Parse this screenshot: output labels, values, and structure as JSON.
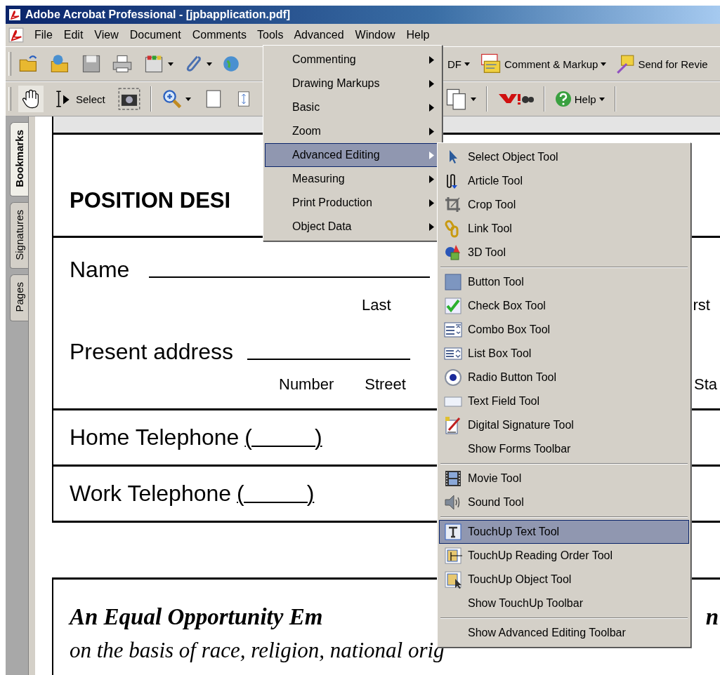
{
  "window": {
    "title": "Adobe Acrobat Professional - [jpbapplication.pdf]"
  },
  "menu_bar": [
    {
      "label": "File",
      "selected": false
    },
    {
      "label": "Edit",
      "selected": false
    },
    {
      "label": "View",
      "selected": false
    },
    {
      "label": "Document",
      "selected": false
    },
    {
      "label": "Comments",
      "selected": false
    },
    {
      "label": "Tools",
      "selected": true
    },
    {
      "label": "Advanced",
      "selected": false
    },
    {
      "label": "Window",
      "selected": false
    },
    {
      "label": "Help",
      "selected": false
    }
  ],
  "toolbar_top": {
    "partial_label": "DF",
    "comment_label": "Comment & Markup",
    "review_label": "Send for Revie"
  },
  "toolbar_bottom": {
    "select_label": "Select",
    "help_label": "Help"
  },
  "nav_tabs": [
    {
      "label": "Bookmarks",
      "selected": true
    },
    {
      "label": "Signatures",
      "selected": false
    },
    {
      "label": "Pages",
      "selected": false
    }
  ],
  "document": {
    "heading": "POSITION DESI",
    "name_label": "Name",
    "last_caption": "Last",
    "first_caption_fragment": "rst",
    "address_label": "Present address",
    "number_caption": "Number",
    "street_caption": "Street",
    "state_caption_fragment": "Sta",
    "home_phone_label": "Home Telephone",
    "home_phone_blank": "(          )",
    "work_phone_label": "Work Telephone",
    "work_phone_blank": "(          )",
    "statement_line_1": "An Equal Opportunity Em",
    "statement_fragment": "n",
    "statement_line_2": "on the basis of race, religion, national orig"
  },
  "tools_menu": [
    {
      "label": "Commenting",
      "selected": false
    },
    {
      "label": "Drawing Markups",
      "selected": false
    },
    {
      "label": "Basic",
      "selected": false
    },
    {
      "label": "Zoom",
      "selected": false
    },
    {
      "label": "Advanced Editing",
      "selected": true
    },
    {
      "label": "Measuring",
      "selected": false
    },
    {
      "label": "Print Production",
      "selected": false
    },
    {
      "label": "Object Data",
      "selected": false
    }
  ],
  "advanced_editing_menu": [
    {
      "kind": "tool",
      "label": "Select Object Tool",
      "selected": false
    },
    {
      "kind": "tool",
      "label": "Article Tool",
      "selected": false
    },
    {
      "kind": "tool",
      "label": "Crop Tool",
      "selected": false
    },
    {
      "kind": "tool",
      "label": "Link Tool",
      "selected": false
    },
    {
      "kind": "tool",
      "label": "3D Tool",
      "selected": false
    },
    {
      "kind": "separator"
    },
    {
      "kind": "tool",
      "label": "Button Tool",
      "selected": false
    },
    {
      "kind": "tool",
      "label": "Check Box Tool",
      "selected": false
    },
    {
      "kind": "tool",
      "label": "Combo Box Tool",
      "selected": false
    },
    {
      "kind": "tool",
      "label": "List Box Tool",
      "selected": false
    },
    {
      "kind": "tool",
      "label": "Radio Button Tool",
      "selected": false
    },
    {
      "kind": "tool",
      "label": "Text Field Tool",
      "selected": false
    },
    {
      "kind": "tool",
      "label": "Digital Signature Tool",
      "selected": false
    },
    {
      "kind": "command",
      "label": "Show Forms Toolbar",
      "selected": false
    },
    {
      "kind": "separator"
    },
    {
      "kind": "tool",
      "label": "Movie Tool",
      "selected": false
    },
    {
      "kind": "tool",
      "label": "Sound Tool",
      "selected": false
    },
    {
      "kind": "separator"
    },
    {
      "kind": "tool",
      "label": "TouchUp Text Tool",
      "selected": true
    },
    {
      "kind": "tool",
      "label": "TouchUp Reading Order Tool",
      "selected": false
    },
    {
      "kind": "tool",
      "label": "TouchUp Object Tool",
      "selected": false
    },
    {
      "kind": "command",
      "label": "Show TouchUp Toolbar",
      "selected": false
    },
    {
      "kind": "separator"
    },
    {
      "kind": "command",
      "label": "Show Advanced Editing Toolbar",
      "selected": false
    }
  ]
}
